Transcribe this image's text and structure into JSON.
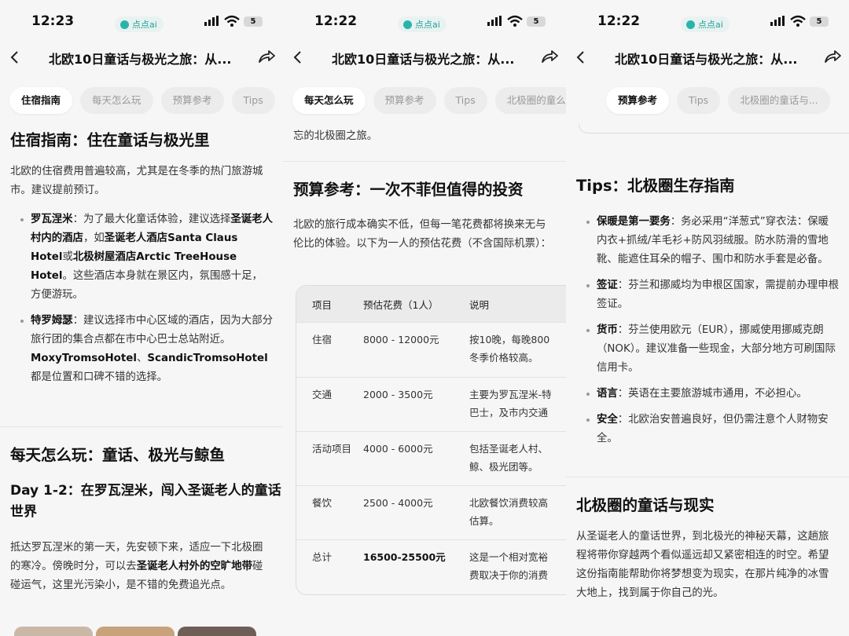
{
  "status": {
    "time1": "12:23",
    "time2": "12:22",
    "time3": "12:22",
    "app_pill": "点点ai",
    "battery": "5"
  },
  "header": {
    "title": "北欧10日童话与极光之旅：从..."
  },
  "panel1": {
    "tabs": [
      "住宿指南",
      "每天怎么玩",
      "预算参考",
      "Tips"
    ],
    "lodging_title": "住宿指南：住在童话与极光里",
    "lodging_intro": "北欧的住宿费用普遍较高，尤其是在冬季的热门旅游城市。建议提前预订。",
    "lodging_items": [
      {
        "label": "罗瓦涅米",
        "text": "：为了最大化童话体验，建议选择",
        "bold": "圣诞老人村内的酒店",
        "text2": "，如",
        "bold2": "圣诞老人酒店Santa Claus Hotel",
        "text3": "或",
        "bold3": "北极树屋酒店Arctic TreeHouse Hotel",
        "text4": "。这些酒店本身就在景区内，氛围感十足，方便游玩。"
      },
      {
        "label": "特罗姆瑟",
        "text": "：建议选择市中心区域的酒店，因为大部分旅行团的集合点都在市中心巴士总站附近。",
        "bold": "MoxyTromsoHotel",
        "text2": "、",
        "bold2": "ScandicTromsoHotel",
        "text3": "都是位置和口碑不错的选择。"
      }
    ],
    "play_title": "每天怎么玩：童话、极光与鲸鱼",
    "day_title": "Day 1-2：在罗瓦涅米，闯入圣诞老人的童话世界",
    "day_text_a": "抵达罗瓦涅米的第一天，先安顿下来，适应一下北极圈的寒冷。傍晚时分，可以去",
    "day_text_b": "圣诞老人村外的空旷地带",
    "day_text_c": "碰碰运气，这里光污染小，是不错的免费追光点。"
  },
  "panel2": {
    "tabs": [
      "每天怎么玩",
      "预算参考",
      "Tips",
      "北极圈的童么玩"
    ],
    "top_fragment": "忘的北极圈之旅。",
    "budget_title": "预算参考：一次不菲但值得的投资",
    "budget_intro": "北欧的旅行成本确实不低，但每一笔花费都将换来无与伦比的体验。以下为一人的预估花费（不含国际机票）：",
    "table_headers": [
      "项目",
      "预估花费（1人）",
      "说明"
    ],
    "table_rows": [
      {
        "item": "住宿",
        "cost": "8000 - 12000元",
        "note1": "按10晚，每晚800",
        "note2": "冬季价格较高。"
      },
      {
        "item": "交通",
        "cost": "2000 - 3500元",
        "note1": "主要为罗瓦涅米-特",
        "note2": "巴士，及市内交通"
      },
      {
        "item": "活动项目",
        "cost": "4000 - 6000元",
        "note1": "包括圣诞老人村、",
        "note2": "鲸、极光团等。"
      },
      {
        "item": "餐饮",
        "cost": "2500 - 4000元",
        "note1": "北欧餐饮消费较高",
        "note2": "估算。"
      },
      {
        "item": "总计",
        "cost": "16500-25500元",
        "note1": "这是一个相对宽裕",
        "note2": "费取决于你的消费"
      }
    ]
  },
  "panel3": {
    "tabs": [
      "预算参考",
      "Tips",
      "北极圈的童话与..."
    ],
    "tips_title": "Tips：北极圈生存指南",
    "tips": [
      {
        "label": "保暖是第一要务",
        "text": "：务必采用“洋葱式”穿衣法：保暖内衣+抓绒/羊毛衫+防风羽绒服。防水防滑的雪地靴、能遮住耳朵的帽子、围巾和防水手套是必备。"
      },
      {
        "label": "签证",
        "text": "：芬兰和挪威均为申根区国家，需提前办理申根签证。"
      },
      {
        "label": "货币",
        "text": "：芬兰使用欧元（EUR），挪威使用挪威克朗（NOK）。建议准备一些现金，大部分地方可刷国际信用卡。"
      },
      {
        "label": "语言",
        "text": "：英语在主要旅游城市通用，不必担心。"
      },
      {
        "label": "安全",
        "text": "：北欧治安普遍良好，但仍需注意个人财物安全。"
      }
    ],
    "reality_title": "北极圈的童话与现实",
    "reality_text": "从圣诞老人的童话世界，到北极光的神秘天幕，这趟旅程将带你穿越两个看似遥远却又紧密相连的时空。希望这份指南能帮助你将梦想变为现实，在那片纯净的冰雪大地上，找到属于你自己的光。"
  },
  "colors": {
    "accent": "#2bb3aa",
    "pill_bg": "#e8f2f1",
    "page_bg": "#f6f6f6"
  }
}
